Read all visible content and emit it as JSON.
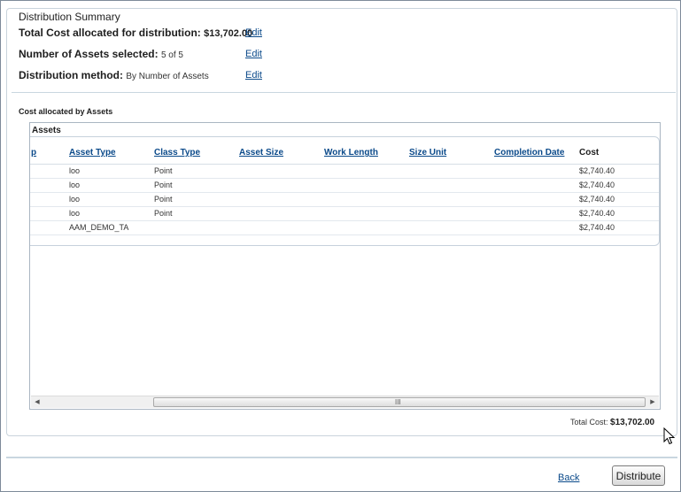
{
  "summary": {
    "legend": "Distribution Summary",
    "total_cost_label": "Total Cost allocated for distribution:",
    "total_cost_value": "$13,702.00",
    "assets_selected_label": "Number of Assets selected:",
    "assets_selected_value": "5 of 5",
    "method_label": "Distribution method:",
    "method_value": "By Number of Assets",
    "edit_label": "Edit"
  },
  "allocation": {
    "section_title": "Cost allocated by Assets",
    "panel_title": "Assets",
    "columns": [
      "p",
      "Asset Type",
      "Class Type",
      "Asset Size",
      "Work Length",
      "Size Unit",
      "Completion Date",
      "Cost"
    ],
    "rows": [
      {
        "asset_type": "loo",
        "class_type": "Point",
        "cost": "$2,740.40"
      },
      {
        "asset_type": "loo",
        "class_type": "Point",
        "cost": "$2,740.40"
      },
      {
        "asset_type": "loo",
        "class_type": "Point",
        "cost": "$2,740.40"
      },
      {
        "asset_type": "loo",
        "class_type": "Point",
        "cost": "$2,740.40"
      },
      {
        "asset_type": "AAM_DEMO_TA",
        "class_type": "",
        "cost": "$2,740.40"
      }
    ],
    "scroll_grip": "III",
    "total_label": "Total Cost:",
    "total_value": "$13,702.00"
  },
  "footer": {
    "back_label": "Back",
    "distribute_label": "Distribute"
  },
  "icons": {
    "scroll_left": "triangle-left-icon",
    "scroll_right": "triangle-right-icon",
    "cursor": "mouse-pointer-icon"
  }
}
